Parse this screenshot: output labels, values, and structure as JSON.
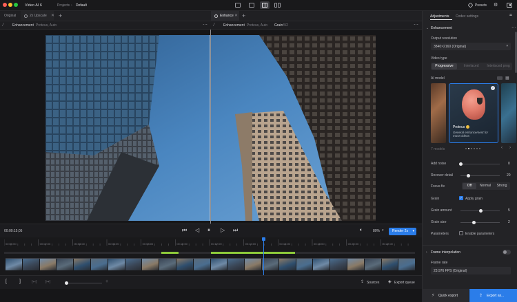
{
  "app": {
    "title": "Video AI 6",
    "breadcrumb_root": "Projects",
    "breadcrumb_sep": "›",
    "breadcrumb_item": "Default",
    "presets_label": "Presets"
  },
  "tabs": {
    "original": "Original",
    "upscale": "2x Upscale",
    "enhance": "Enhance"
  },
  "subheader": {
    "left_title": "Enhancement",
    "left_detail": "Proteus, Auto",
    "right_title": "Enhancement",
    "right_detail": "Proteus, Auto",
    "right_grain": "Grain",
    "right_grain_detail": "5/2"
  },
  "transport": {
    "timecode": "00:00:15;05",
    "zoom": "80%",
    "render_label": "Render 2x"
  },
  "timeline": {
    "ticks": [
      "00:00:00",
      "00:02:00",
      "00:04:00",
      "00:06:00",
      "00:08:00",
      "00:10:00",
      "00:12:00",
      "00:14:00",
      "00:16:00",
      "00:18:00",
      "00:20:00",
      "00:22:00"
    ]
  },
  "bottom": {
    "sources_label": "Sources",
    "export_queue_label": "Export queue"
  },
  "footer": {
    "quick_export": "Quick export",
    "export_as": "Export as..."
  },
  "panel": {
    "tab_adjustments": "Adjustments",
    "tab_codec": "Codec settings",
    "section_enhancement": "Enhancement",
    "output_resolution_label": "Output resolution",
    "output_resolution_value": "3840×2160 (Original)",
    "video_type_label": "Video type",
    "video_types": [
      "Progressive",
      "Interlaced",
      "Interlaced prog"
    ],
    "ai_model_label": "AI model",
    "model_name": "Proteus",
    "model_desc": "General enhancement for most videos",
    "models_count": "7 models",
    "add_noise_label": "Add noise",
    "add_noise_value": "0",
    "recover_detail_label": "Recover detail",
    "recover_detail_value": "20",
    "focus_fix_label": "Focus fix",
    "focus_fix_options": [
      "Off",
      "Normal",
      "Strong"
    ],
    "grain_label": "Grain",
    "apply_grain_label": "Apply grain",
    "grain_amount_label": "Grain amount",
    "grain_amount_value": "5",
    "grain_size_label": "Grain size",
    "grain_size_value": "2",
    "parameters_label": "Parameters",
    "enable_parameters_label": "Enable parameters",
    "frame_interp_label": "Frame interpolation",
    "frame_rate_label": "Frame rate",
    "frame_rate_value": "23.976 FPS (Original)"
  },
  "colors": {
    "accent": "#2b7de9",
    "green": "#8ecb3a",
    "sky": "#4a86c0",
    "flamingo": "#e07a6a"
  },
  "sliders": {
    "add_noise": 0.0,
    "recover_detail": 0.2,
    "grain_amount": 0.5,
    "grain_size": 0.33,
    "playhead": 0.62
  }
}
